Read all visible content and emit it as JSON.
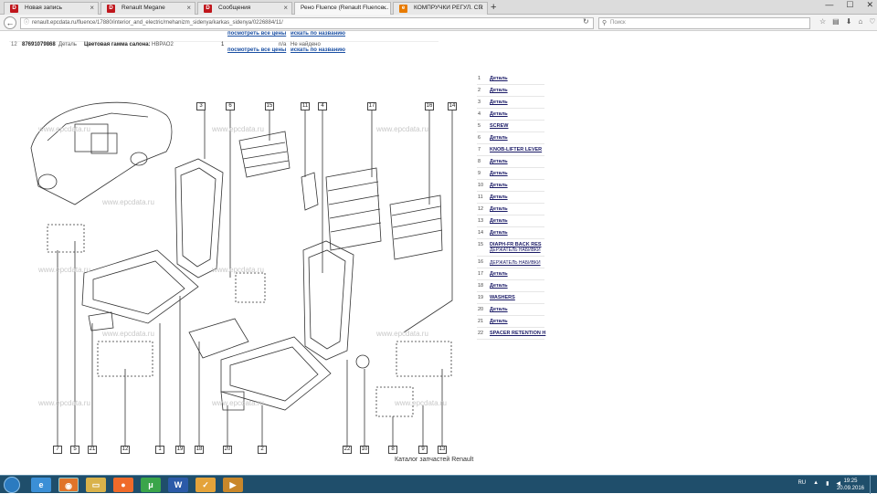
{
  "tabs": [
    {
      "label": "Новая запись",
      "icon": "D"
    },
    {
      "label": "Renault Megane",
      "icon": "D"
    },
    {
      "label": "Сообщения",
      "icon": "D"
    },
    {
      "label": "Рено Fluence (Renault Fluence...",
      "icon": ""
    },
    {
      "label": "КОМПРУЧКИ РЕГУЛ. СП",
      "icon": "e"
    }
  ],
  "url": "renault.epcdata.ru/fluence/17880/interior_and_electric/mehanizm_sidenya/karkas_sidenya/0226884/11/",
  "search_placeholder": "Поиск",
  "top_rows": {
    "row1": {
      "all_prices": "посмотреть все цены",
      "search_by_name": "искать по названию"
    },
    "row2": {
      "num": "12",
      "code": "87691079868",
      "type": "Деталь",
      "name": "Цветовая гамма салона:",
      "color": "НВРАО2",
      "qty": "1",
      "na": "n/a",
      "status": "Не найдено",
      "all_prices": "посмотреть все цены",
      "search_by_name": "искать по названию"
    }
  },
  "callouts_top": [
    "3",
    "6",
    "15",
    "11",
    "4",
    "17",
    "16",
    "14"
  ],
  "callouts_bottom": [
    "7",
    "5",
    "21",
    "12",
    "1",
    "19",
    "18",
    "20",
    "2",
    "22",
    "10",
    "8",
    "9",
    "13"
  ],
  "watermark": "www.epcdata.ru",
  "parts": [
    {
      "num": "1",
      "label": "Деталь"
    },
    {
      "num": "2",
      "label": "Деталь"
    },
    {
      "num": "3",
      "label": "Деталь"
    },
    {
      "num": "4",
      "label": "Деталь"
    },
    {
      "num": "5",
      "label": "SCREW"
    },
    {
      "num": "6",
      "label": "Деталь"
    },
    {
      "num": "7",
      "label": "KNOB-LIFTER LEVER"
    },
    {
      "num": "8",
      "label": "Деталь"
    },
    {
      "num": "9",
      "label": "Деталь"
    },
    {
      "num": "10",
      "label": "Деталь"
    },
    {
      "num": "11",
      "label": "Деталь"
    },
    {
      "num": "12",
      "label": "Деталь"
    },
    {
      "num": "13",
      "label": "Деталь"
    },
    {
      "num": "14",
      "label": "Деталь"
    },
    {
      "num": "15",
      "label": "DIAPH-FR BACK RES",
      "sub": "ДЕРЖАТЕЛЬ НАБИВКИ"
    },
    {
      "num": "16",
      "label": "ДЕРЖАТЕЛЬ НАБИВКИ"
    },
    {
      "num": "17",
      "label": "Деталь"
    },
    {
      "num": "18",
      "label": "Деталь"
    },
    {
      "num": "19",
      "label": "WASHERS"
    },
    {
      "num": "20",
      "label": "Деталь"
    },
    {
      "num": "21",
      "label": "Деталь"
    },
    {
      "num": "22",
      "label": "SPACER RETENTION H"
    }
  ],
  "footer": "Каталог запчастей Renault",
  "taskbar": {
    "lang": "RU",
    "time": "19:25",
    "date": "20.09.2016"
  }
}
